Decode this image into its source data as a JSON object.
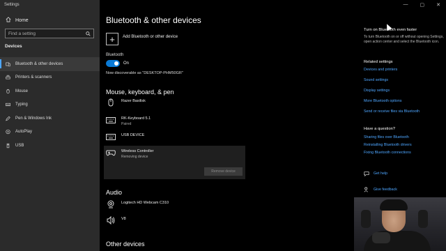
{
  "window": {
    "title": "Settings",
    "controls": [
      "—",
      "▢",
      "✕"
    ]
  },
  "sidebar": {
    "home_label": "Home",
    "search_placeholder": "Find a setting",
    "section_label": "Devices",
    "items": [
      {
        "label": "Bluetooth & other devices",
        "icon": "bluetooth-devices-icon",
        "active": true
      },
      {
        "label": "Printers & scanners",
        "icon": "printer-icon",
        "active": false
      },
      {
        "label": "Mouse",
        "icon": "mouse-icon",
        "active": false
      },
      {
        "label": "Typing",
        "icon": "keyboard-icon",
        "active": false
      },
      {
        "label": "Pen & Windows Ink",
        "icon": "pen-icon",
        "active": false
      },
      {
        "label": "AutoPlay",
        "icon": "autoplay-icon",
        "active": false
      },
      {
        "label": "USB",
        "icon": "usb-icon",
        "active": false
      }
    ]
  },
  "main": {
    "title": "Bluetooth & other devices",
    "add_label": "Add Bluetooth or other device",
    "bluetooth_label": "Bluetooth",
    "toggle_state": "On",
    "discoverable": "Now discoverable as \"DESKTOP-PHM50GR\"",
    "groups": {
      "mouse_keyboard_pen": {
        "title": "Mouse, keyboard, & pen",
        "devices": [
          {
            "name": "Razer Basilisk",
            "status": "",
            "icon": "mouse-icon"
          },
          {
            "name": "RK-Keyboard 5.1",
            "status": "Paired",
            "icon": "keyboard-icon"
          },
          {
            "name": "USB DEVICE",
            "status": "",
            "icon": "keyboard-icon"
          },
          {
            "name": "Wireless Controller",
            "status": "Removing device",
            "icon": "gamepad-icon"
          }
        ],
        "remove_button": "Remove device"
      },
      "audio": {
        "title": "Audio",
        "devices": [
          {
            "name": "Logitech HD Webcam C310",
            "icon": "webcam-icon"
          },
          {
            "name": "V8",
            "icon": "speaker-icon"
          }
        ]
      },
      "other": {
        "title": "Other devices"
      }
    }
  },
  "aside": {
    "faster_title": "Turn on Bluetooth even faster",
    "faster_text": "To turn Bluetooth on or off without opening Settings, open action center and select the Bluetooth icon.",
    "related_title": "Related settings",
    "related_links": [
      "Devices and printers",
      "Sound settings",
      "Display settings",
      "More Bluetooth options",
      "Send or receive files via Bluetooth"
    ],
    "question_title": "Have a question?",
    "question_links": [
      "Sharing files over Bluetooth",
      "Reinstalling Bluetooth drivers",
      "Fixing Bluetooth connections"
    ],
    "get_help": "Get help",
    "give_feedback": "Give feedback"
  },
  "colors": {
    "accent": "#0a7ad6",
    "link": "#4ea6ff",
    "sidebar_bg": "#2b2b2b"
  }
}
